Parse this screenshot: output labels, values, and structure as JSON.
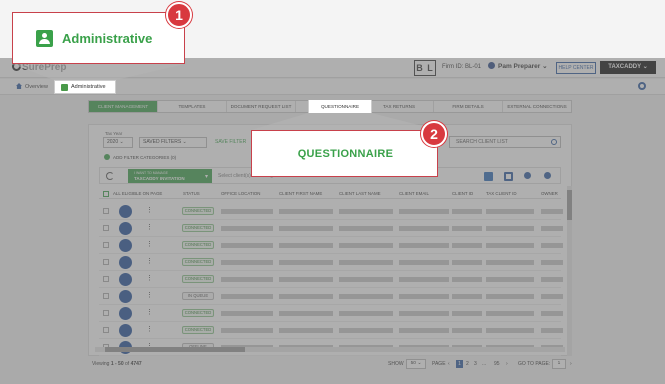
{
  "header": {
    "logo_text": "SurePrep",
    "firm_initials": "B L",
    "firm_id": "Firm ID: BL-01",
    "user_name": "Pam Preparer",
    "help_center": "HELP CENTER",
    "taxcaddy": "TAXCADDY"
  },
  "breadcrumb": {
    "overview": "Overview",
    "administrative": "Administrative"
  },
  "tabs": [
    {
      "label": "CLIENT MANAGEMENT",
      "active": true
    },
    {
      "label": "TEMPLATES"
    },
    {
      "label": "DOCUMENT REQUEST LIST"
    },
    {
      "label": "QUESTIONNAIRE"
    },
    {
      "label": "TAX RETURNS"
    },
    {
      "label": "FIRM DETAILS"
    },
    {
      "label": "EXTERNAL CONNECTIONS"
    }
  ],
  "filters": {
    "tax_year_label": "Tax Year",
    "tax_year_value": "2020",
    "saved_filters": "SAVED FILTERS",
    "save_filter": "SAVE FILTER",
    "search_placeholder": "SEARCH CLIENT LIST",
    "add_filter": "ADD FILTER CATEGORIES",
    "add_filter_count": "(0)"
  },
  "action_bar": {
    "wizard_line1": "I WANT TO MANAGE",
    "wizard_line2": "TAXCADDY INVITATION",
    "select_placeholder": "Select client(s) to manage"
  },
  "grid": {
    "columns": [
      "ALL ELIGIBLE ON PAGE",
      "STATUS",
      "OFFICE LOCATION",
      "CLIENT FIRST NAME",
      "CLIENT LAST NAME",
      "CLIENT EMAIL",
      "CLIENT ID",
      "TAX CLIENT ID",
      "OWNER"
    ],
    "rows": [
      {
        "status": "CONNECTED"
      },
      {
        "status": "CONNECTED"
      },
      {
        "status": "CONNECTED"
      },
      {
        "status": "CONNECTED"
      },
      {
        "status": "CONNECTED"
      },
      {
        "status": "IN QUEUE"
      },
      {
        "status": "CONNECTED"
      },
      {
        "status": "CONNECTED"
      },
      {
        "status": "OFFLINE"
      }
    ]
  },
  "footer": {
    "viewing_prefix": "Viewing",
    "viewing_range": "1 - 50",
    "viewing_of": "of",
    "viewing_total": "4747",
    "show_label": "SHOW",
    "show_value": "50",
    "page_label": "PAGE",
    "pages": [
      "1",
      "2",
      "3",
      "...",
      "95"
    ],
    "goto_label": "GO TO PAGE:",
    "goto_value": "1"
  },
  "callouts": {
    "administrative": {
      "number": "1",
      "label": "Administrative"
    },
    "questionnaire": {
      "number": "2",
      "label": "QUESTIONNAIRE"
    }
  },
  "colors": {
    "brand_green": "#3aa14a",
    "callout_red": "#d8393f",
    "avatar_blue": "#1f4f99"
  }
}
